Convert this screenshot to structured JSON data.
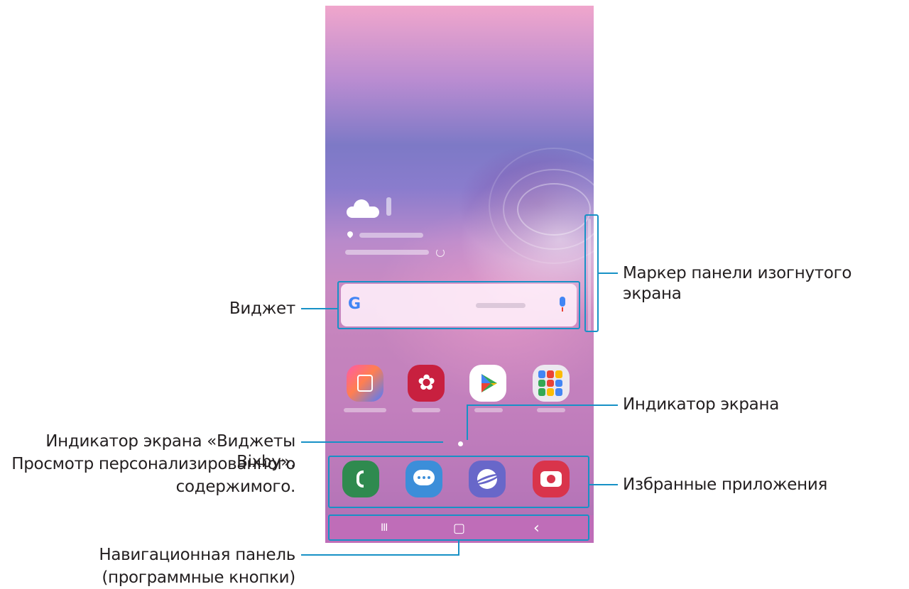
{
  "labels": {
    "edge_handle": "Маркер панели изогнутого экрана",
    "widget": "Виджет",
    "screen_indicator": "Индикатор экрана",
    "bixby_line1": "Индикатор экрана «Виджеты Bixby».",
    "bixby_line2": "Просмотр персонализированного",
    "bixby_line3": "содержимого.",
    "favorite_apps": "Избранные приложения",
    "navbar_line1": "Навигационная панель",
    "navbar_line2": "(программные кнопки)"
  },
  "phone": {
    "search_logo": "G",
    "nav_recent": "III",
    "nav_home": "▢",
    "nav_back": "‹"
  },
  "icons": {
    "apps": [
      "galaxy-store-icon",
      "gallery-icon",
      "play-store-icon",
      "google-folder-icon"
    ],
    "dock": [
      "phone-icon",
      "messages-icon",
      "internet-icon",
      "camera-icon"
    ]
  },
  "colors": {
    "callout": "#1791c6",
    "navbar": "#bf6db8"
  }
}
